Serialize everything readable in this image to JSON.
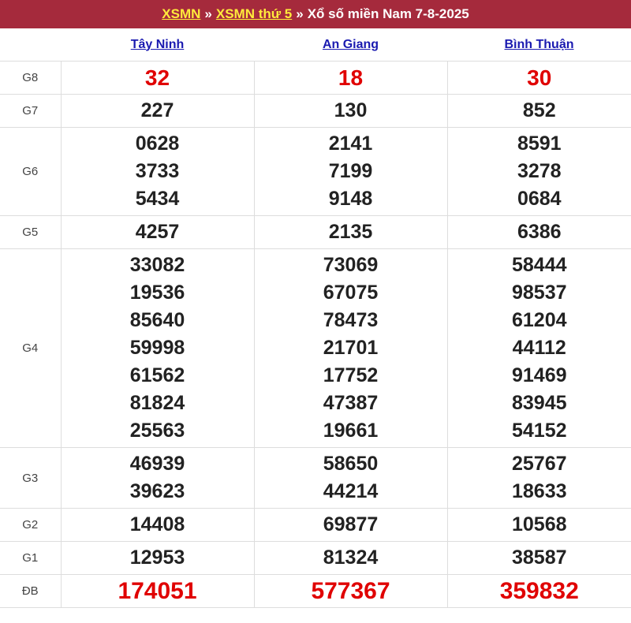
{
  "header": {
    "link1": "XSMN",
    "sep1": "»",
    "link2": "XSMN thứ 5",
    "sep2": "»",
    "title": "Xổ số miền Nam 7-8-2025"
  },
  "provinces": [
    "Tây Ninh",
    "An Giang",
    "Bình Thuận"
  ],
  "prizes": [
    {
      "label": "G8",
      "values": [
        [
          "32"
        ],
        [
          "18"
        ],
        [
          "30"
        ]
      ]
    },
    {
      "label": "G7",
      "values": [
        [
          "227"
        ],
        [
          "130"
        ],
        [
          "852"
        ]
      ]
    },
    {
      "label": "G6",
      "values": [
        [
          "0628",
          "3733",
          "5434"
        ],
        [
          "2141",
          "7199",
          "9148"
        ],
        [
          "8591",
          "3278",
          "0684"
        ]
      ]
    },
    {
      "label": "G5",
      "values": [
        [
          "4257"
        ],
        [
          "2135"
        ],
        [
          "6386"
        ]
      ]
    },
    {
      "label": "G4",
      "values": [
        [
          "33082",
          "19536",
          "85640",
          "59998",
          "61562",
          "81824",
          "25563"
        ],
        [
          "73069",
          "67075",
          "78473",
          "21701",
          "17752",
          "47387",
          "19661"
        ],
        [
          "58444",
          "98537",
          "61204",
          "44112",
          "91469",
          "83945",
          "54152"
        ]
      ]
    },
    {
      "label": "G3",
      "values": [
        [
          "46939",
          "39623"
        ],
        [
          "58650",
          "44214"
        ],
        [
          "25767",
          "18633"
        ]
      ]
    },
    {
      "label": "G2",
      "values": [
        [
          "14408"
        ],
        [
          "69877"
        ],
        [
          "10568"
        ]
      ]
    },
    {
      "label": "G1",
      "values": [
        [
          "12953"
        ],
        [
          "81324"
        ],
        [
          "38587"
        ]
      ]
    },
    {
      "label": "ĐB",
      "values": [
        [
          "174051"
        ],
        [
          "577367"
        ],
        [
          "359832"
        ]
      ]
    }
  ],
  "colors": {
    "header_bg": "#a52a3c",
    "header_link": "#ffeb3b",
    "highlight": "#e00000",
    "province_link": "#1a1ab0"
  }
}
